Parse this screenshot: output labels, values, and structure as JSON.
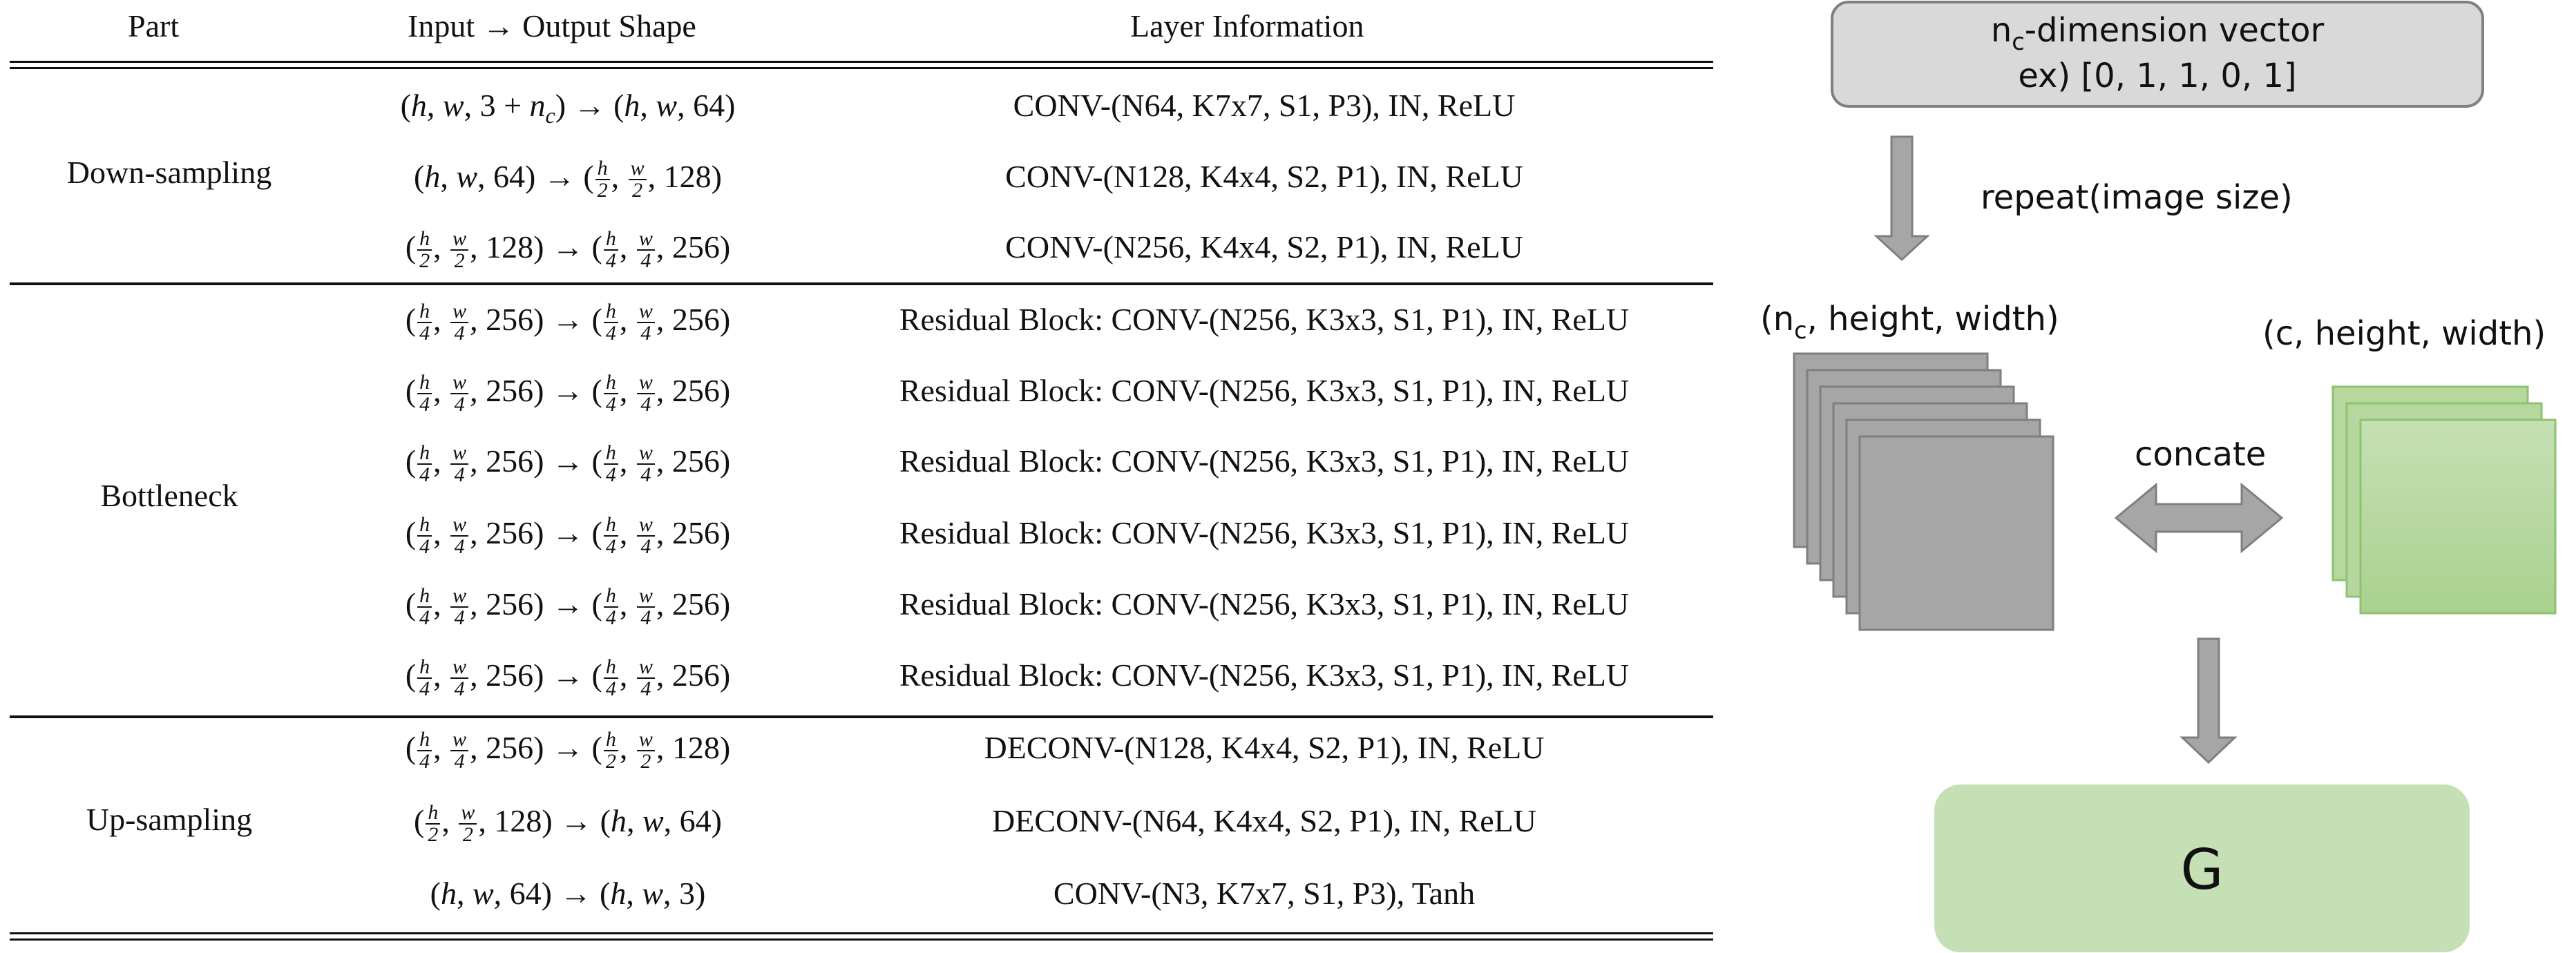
{
  "table": {
    "headers": {
      "part": "Part",
      "shape": "Input → Output Shape",
      "layer": "Layer Information"
    },
    "rows": [
      {
        "part": "Down-sampling",
        "shape": [
          [
            "(",
            "h",
            ", ",
            "w",
            ", 3 + n",
            "c",
            ") → (",
            "h",
            ", ",
            "w",
            ", 64)"
          ]
        ],
        "layer": "CONV-(N64, K7x7, S1, P3), IN, ReLU"
      },
      {
        "shape": "(h, w, 64) → (h/2, w/2, 128)",
        "layer": "CONV-(N128, K4x4, S2, P1), IN, ReLU"
      },
      {
        "shape": "(h/2, w/2, 128) → (h/4, w/4, 256)",
        "layer": "CONV-(N256, K4x4, S2, P1), IN, ReLU"
      },
      {
        "part": "Bottleneck",
        "shape": "(h/4, w/4, 256) → (h/4, w/4, 256)",
        "layer": "Residual Block: CONV-(N256, K3x3, S1, P1), IN, ReLU"
      },
      {
        "shape": "(h/4, w/4, 256) → (h/4, w/4, 256)",
        "layer": "Residual Block: CONV-(N256, K3x3, S1, P1), IN, ReLU"
      },
      {
        "shape": "(h/4, w/4, 256) → (h/4, w/4, 256)",
        "layer": "Residual Block: CONV-(N256, K3x3, S1, P1), IN, ReLU"
      },
      {
        "shape": "(h/4, w/4, 256) → (h/4, w/4, 256)",
        "layer": "Residual Block: CONV-(N256, K3x3, S1, P1), IN, ReLU"
      },
      {
        "shape": "(h/4, w/4, 256) → (h/4, w/4, 256)",
        "layer": "Residual Block: CONV-(N256, K3x3, S1, P1), IN, ReLU"
      },
      {
        "shape": "(h/4, w/4, 256) → (h/4, w/4, 256)",
        "layer": "Residual Block: CONV-(N256, K3x3, S1, P1), IN, ReLU"
      },
      {
        "part": "Up-sampling",
        "shape": "(h/4, w/4, 256) → (h/2, w/2, 128)",
        "layer": "DECONV-(N128, K4x4, S2, P1), IN, ReLU"
      },
      {
        "shape": "(h/2, w/2, 128) → (h, w, 64)",
        "layer": "DECONV-(N64, K4x4, S2, P1), IN, ReLU"
      },
      {
        "shape": "(h, w, 64) → (h, w, 3)",
        "layer": "CONV-(N3, K7x7, S1, P3), Tanh"
      }
    ]
  },
  "diagram": {
    "vector_box": {
      "line1_pre": "n",
      "line1_sub": "c",
      "line1_post": "-dimension vector",
      "line2": "ex) [0, 1, 1, 0, 1]"
    },
    "repeat_label": "repeat(image size)",
    "stack_left_label": {
      "pre": "(n",
      "sub": "c",
      "post": ", height, width)"
    },
    "stack_right_label": "(c, height, width)",
    "concat_label": "concate",
    "generator_label": "G",
    "colors": {
      "gray_fill": "#a6a6a6",
      "gray_stroke": "#7f7f7f",
      "box_fill": "#d9d9d9",
      "box_stroke": "#808080",
      "green_light": "#c5e0b4",
      "green_dark": "#a9d18e",
      "green_stroke": "#8cc270"
    }
  }
}
